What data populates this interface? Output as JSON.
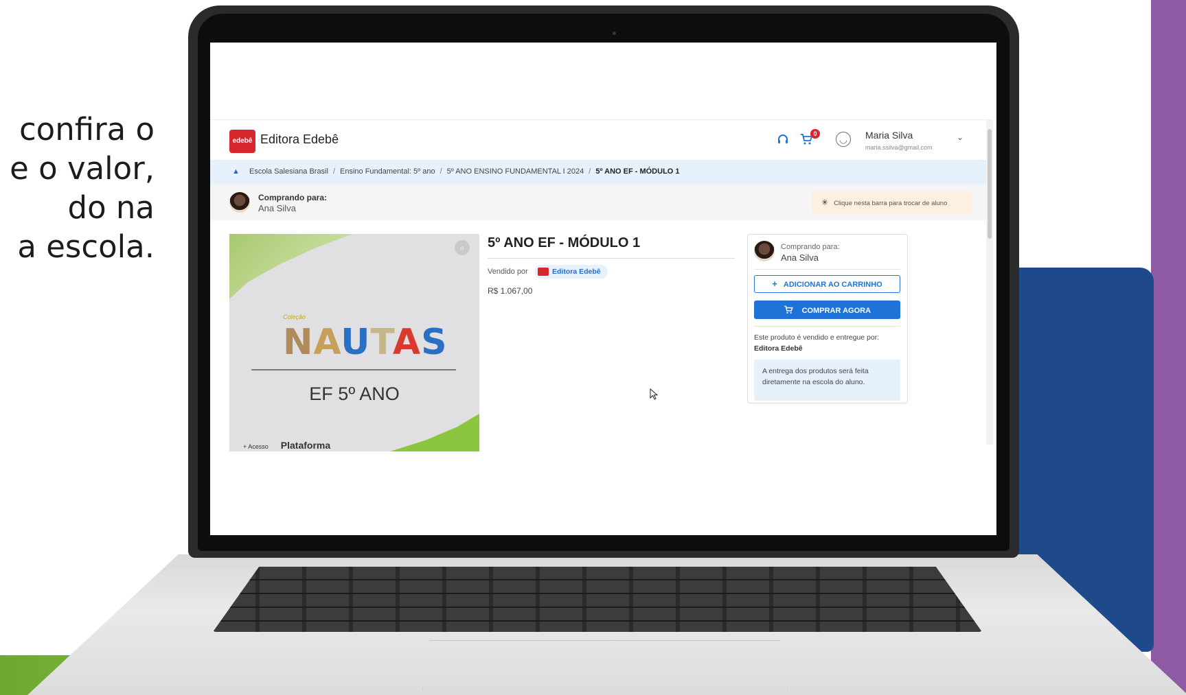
{
  "side_text": {
    "lines": [
      "confira o",
      "e o valor,",
      "do na",
      "a escola."
    ]
  },
  "header": {
    "logo_badge": "edebê",
    "brand": "Editora Edebê",
    "support_icon": "headset-icon",
    "cart_icon": "cart-icon",
    "cart_count": "0",
    "user_icon": "user-circle-icon",
    "user_name": "Maria Silva",
    "user_email": "maria.ssilva@gmail.com"
  },
  "breadcrumb": {
    "items": [
      "Escola Salesiana Brasil",
      "Ensino Fundamental: 5º ano",
      "5º ANO ENSINO FUNDAMENTAL I 2024"
    ],
    "current": "5º ANO EF - MÓDULO 1"
  },
  "buying_bar": {
    "label": "Comprando para:",
    "student": "Ana Silva",
    "switch_text": "Clique nesta barra para trocar de aluno"
  },
  "product_image": {
    "collection": "Coleção",
    "brand_letters": [
      "N",
      "A",
      "U",
      "T",
      "A",
      "S"
    ],
    "grade": "EF 5º ANO",
    "access_small": "+ Acesso",
    "platform": "Plataforma"
  },
  "product": {
    "title": "5º ANO EF - MÓDULO 1",
    "sold_by_label": "Vendido por",
    "seller": "Editora Edebê",
    "price": "R$ 1.067,00"
  },
  "side_card": {
    "buying_label": "Comprando para:",
    "student": "Ana Silva",
    "add_to_cart": "ADICIONAR AO CARRINHO",
    "buy_now": "COMPRAR AGORA",
    "sold_delivered": "Este produto é vendido e entregue por:",
    "seller": "Editora Edebê",
    "delivery_note": "A entrega dos produtos será feita diretamente na escola do aluno."
  },
  "colors": {
    "accent_blue": "#1f73d8",
    "brand_red": "#d7262c",
    "purple": "#8e5aa3",
    "navy": "#1e4a8c",
    "green": "#8cc63e"
  }
}
